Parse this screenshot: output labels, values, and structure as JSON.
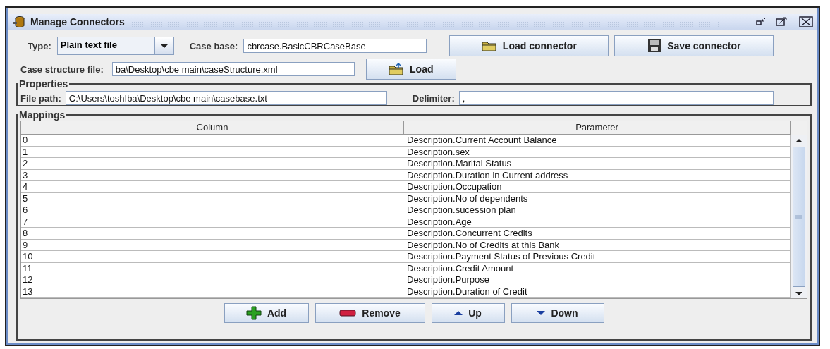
{
  "window": {
    "title": "Manage Connectors"
  },
  "toolbar": {
    "type_label": "Type:",
    "type_value": "Plain text file",
    "case_base_label": "Case base:",
    "case_base_value": "cbrcase.BasicCBRCaseBase",
    "load_connector": "Load connector",
    "save_connector": "Save connector",
    "structure_label": "Case structure file:",
    "structure_value": "ba\\Desktop\\cbe main\\caseStructure.xml",
    "load": "Load"
  },
  "properties": {
    "title": "Properties",
    "file_path_label": "File path:",
    "file_path_value": "C:\\Users\\toshIba\\Desktop\\cbe main\\casebase.txt",
    "delimiter_label": "Delimiter:",
    "delimiter_value": ","
  },
  "mappings": {
    "title": "Mappings",
    "columns": [
      "Column",
      "Parameter"
    ],
    "rows": [
      {
        "column": "0",
        "parameter": "Description.Current Account Balance"
      },
      {
        "column": "1",
        "parameter": "Description.sex"
      },
      {
        "column": "2",
        "parameter": "Description.Marital Status"
      },
      {
        "column": "3",
        "parameter": "Description.Duration in Current address"
      },
      {
        "column": "4",
        "parameter": "Description.Occupation"
      },
      {
        "column": "5",
        "parameter": "Description.No of dependents"
      },
      {
        "column": "6",
        "parameter": "Description.sucession plan"
      },
      {
        "column": "7",
        "parameter": "Description.Age"
      },
      {
        "column": "8",
        "parameter": "Description.Concurrent Credits"
      },
      {
        "column": "9",
        "parameter": "Description.No of Credits at this Bank"
      },
      {
        "column": "10",
        "parameter": "Description.Payment Status of Previous Credit"
      },
      {
        "column": "11",
        "parameter": "Description.Credit Amount"
      },
      {
        "column": "12",
        "parameter": "Description.Purpose"
      },
      {
        "column": "13",
        "parameter": "Description.Duration of Credit"
      }
    ],
    "buttons": [
      {
        "kind": "add",
        "label": "Add"
      },
      {
        "kind": "remove",
        "label": "Remove"
      },
      {
        "kind": "up",
        "label": "Up"
      },
      {
        "kind": "down",
        "label": "Down"
      }
    ]
  }
}
